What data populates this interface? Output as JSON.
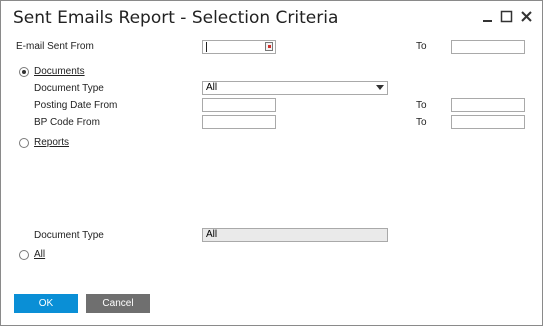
{
  "window": {
    "title": "Sent Emails Report - Selection Criteria"
  },
  "fields": {
    "email_sent_from_label": "E-mail Sent From",
    "email_sent_to_label": "To",
    "documents_label": "Documents",
    "document_type_label": "Document Type",
    "document_type_value": "All",
    "posting_date_from_label": "Posting Date From",
    "posting_date_to_label": "To",
    "bp_code_from_label": "BP Code From",
    "bp_code_to_label": "To",
    "reports_label": "Reports",
    "reports_document_type_label": "Document Type",
    "reports_document_type_value": "All",
    "all_label": "All"
  },
  "buttons": {
    "ok": "OK",
    "cancel": "Cancel"
  },
  "colors": {
    "accent": "#0a8fd6",
    "cancel": "#6f6f6f"
  }
}
